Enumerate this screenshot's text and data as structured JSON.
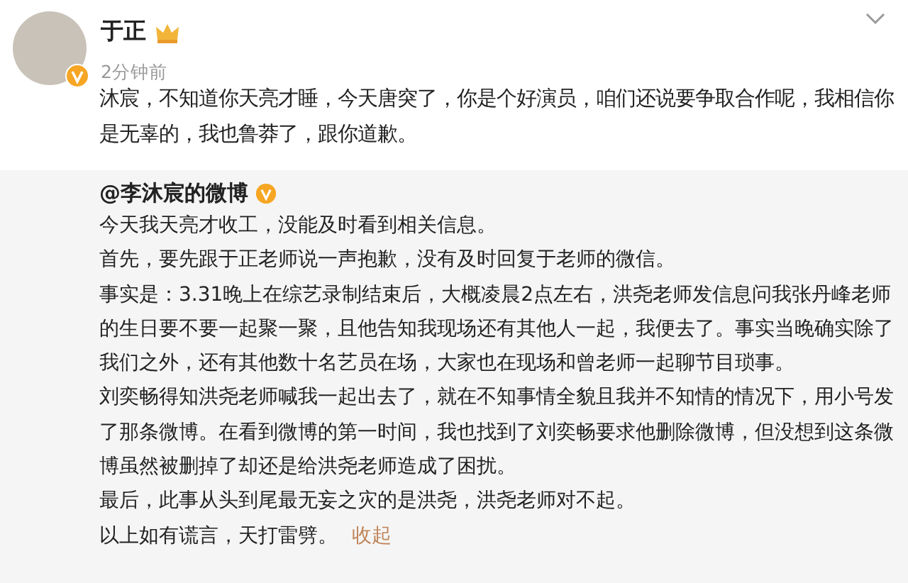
{
  "post": {
    "author": "于正",
    "time": "2分钟前",
    "text": "沐宸，不知道你天亮才睡，今天唐突了，你是个好演员，咱们还说要争取合作呢，我相信你是无辜的，我也鲁莽了，跟你道歉。"
  },
  "repost": {
    "author": "@李沐宸的微博",
    "paragraphs": [
      "今天我天亮才收工，没能及时看到相关信息。",
      "首先，要先跟于正老师说一声抱歉，没有及时回复于老师的微信。",
      "事实是：3.31晚上在综艺录制结束后，大概凌晨2点左右，洪尧老师发信息问我张丹峰老师的生日要不要一起聚一聚，且他告知我现场还有其他人一起，我便去了。事实当晚确实除了我们之外，还有其他数十名艺员在场，大家也在现场和曾老师一起聊节目琐事。",
      "刘奕畅得知洪尧老师喊我一起出去了，就在不知事情全貌且我并不知情的情况下，用小号发了那条微博。在看到微博的第一时间，我也找到了刘奕畅要求他删除微博，但没想到这条微博虽然被删掉了却还是给洪尧老师造成了困扰。",
      "最后，此事从头到尾最无妄之灾的是洪尧，洪尧老师对不起。",
      "以上如有谎言，天打雷劈。"
    ],
    "collapse_link": "收起"
  }
}
